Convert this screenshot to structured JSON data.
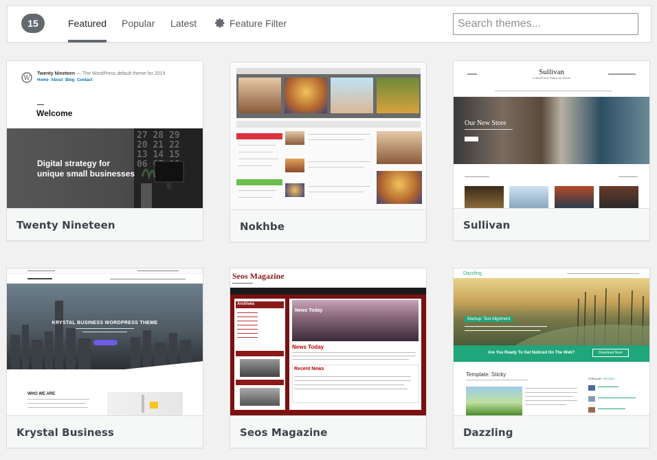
{
  "filter": {
    "count": "15",
    "tabs": [
      "Featured",
      "Popular",
      "Latest"
    ],
    "feature_filter": "Feature Filter",
    "search_placeholder": "Search themes..."
  },
  "themes": [
    {
      "name": "Twenty Nineteen",
      "preview": {
        "site": "Twenty Nineteen",
        "tagline": "— The WordPress default theme for 2019",
        "menu": [
          "Home",
          "About",
          "Blog",
          "Contact"
        ],
        "heading": "Welcome",
        "hero": "Digital strategy for unique small businesses",
        "hero_line1": "Digital strategy for",
        "hero_line2": "unique small businesses"
      }
    },
    {
      "name": "Nokhbe"
    },
    {
      "name": "Sullivan",
      "preview": {
        "logo": "Sullivan",
        "tagline": "A WordPress Theme for Stores",
        "hero": "Our New Store"
      }
    },
    {
      "name": "Krystal Business",
      "preview": {
        "hero": "KRYSTAL BUSINESS WORDPRESS THEME",
        "section": "WHO WE ARE"
      }
    },
    {
      "name": "Seos Magazine",
      "preview": {
        "logo": "Seos Magazine",
        "archives": "Archives",
        "news1": "News Today",
        "news2": "News Today",
        "recent": "Recent News"
      }
    },
    {
      "name": "Dazzling",
      "preview": {
        "logo": "Dazzling",
        "badge": "Markup: Text Alignment",
        "cta": "Are You Ready To Get Noticed On The Web?",
        "cta_btn": "Download Now!",
        "post": "Template: Sticky",
        "tab1": "POPULAR",
        "tab2": "RECENT"
      }
    }
  ],
  "colors": {
    "accent": "#646970",
    "card_footer": "#f6f7f7"
  }
}
